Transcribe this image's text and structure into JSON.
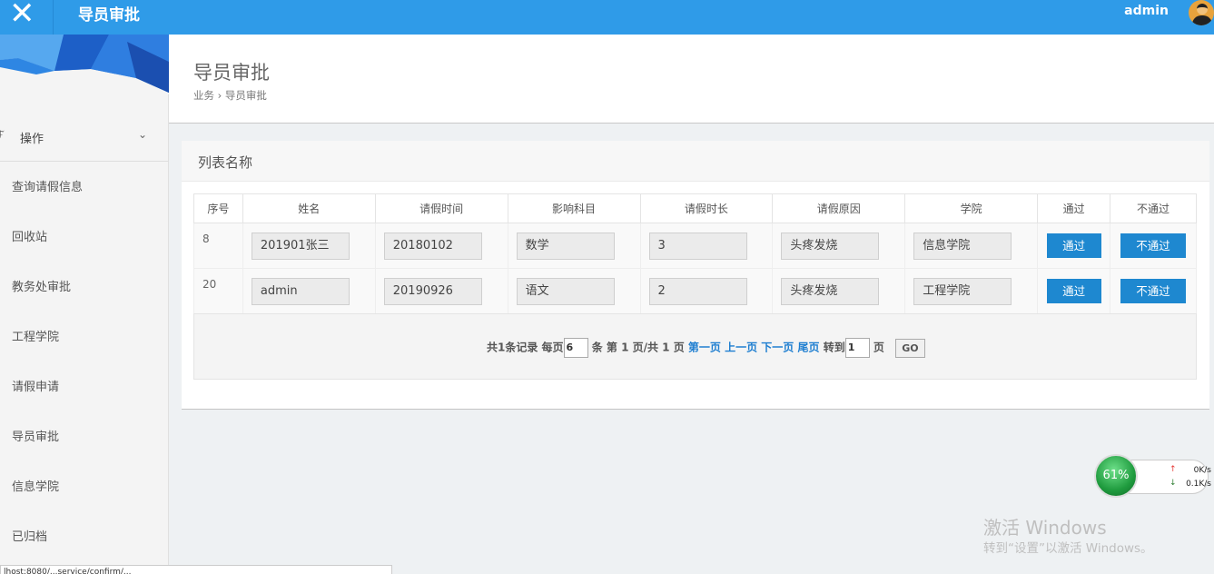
{
  "header": {
    "close_icon": "✕",
    "app_title": "导员审批",
    "user_name": "admin"
  },
  "sidebar": {
    "group": {
      "icon": "ℱ",
      "label": "操作",
      "chevron": "⌄"
    },
    "items": [
      {
        "label": "查询请假信息"
      },
      {
        "label": "回收站"
      },
      {
        "label": "教务处审批"
      },
      {
        "label": "工程学院"
      },
      {
        "label": "请假申请"
      },
      {
        "label": "导员审批"
      },
      {
        "label": "信息学院"
      },
      {
        "label": "已归档"
      }
    ]
  },
  "page": {
    "title": "导员审批",
    "breadcrumb": "业务 › 导员审批"
  },
  "card": {
    "title": "列表名称",
    "columns": [
      "序号",
      "姓名",
      "请假时间",
      "影响科目",
      "请假时长",
      "请假原因",
      "学院",
      "通过",
      "不通过"
    ],
    "rows": [
      {
        "id": "8",
        "name": "201901张三",
        "date": "20180102",
        "subject": "数学",
        "duration": "3",
        "reason": "头疼发烧",
        "college": "信息学院",
        "pass": "通过",
        "reject": "不通过"
      },
      {
        "id": "20",
        "name": "admin",
        "date": "20190926",
        "subject": "语文",
        "duration": "2",
        "reason": "头疼发烧",
        "college": "工程学院",
        "pass": "通过",
        "reject": "不通过"
      }
    ],
    "pager": {
      "records": "共1条记录 每页",
      "per_page": "6",
      "page_info": "条 第 1 页/共 1 页",
      "first": "第一页",
      "prev": "上一页",
      "next": "下一页",
      "last": "尾页",
      "goto": "转到",
      "goto_value": "1",
      "page_suffix": "页",
      "go": "GO"
    }
  },
  "status_bar": "lhost:8080/...service/confirm/...",
  "net_widget": {
    "percent": "61%",
    "up_arrow": "↑",
    "down_arrow": "↓",
    "up": "0K/s",
    "down": "0.1K/s",
    "plus": "+"
  },
  "watermark": {
    "title": "激活 Windows",
    "subtitle": "转到“设置”以激活 Windows。"
  },
  "colors": {
    "topbar": "#2f9be8",
    "button": "#1e88d0",
    "link": "#1e7ed0"
  }
}
